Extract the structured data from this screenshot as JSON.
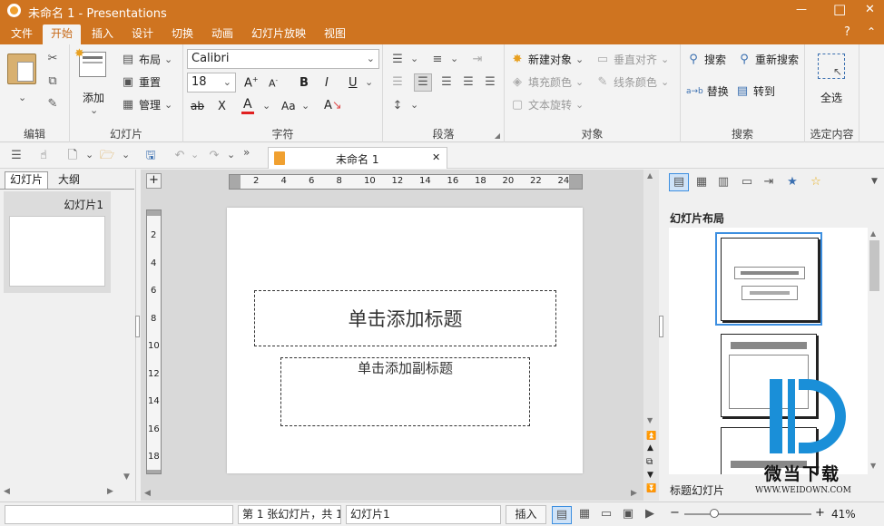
{
  "titlebar": {
    "title": "未命名 1 - Presentations",
    "minimize": "—",
    "maximize": "□",
    "close": "✕"
  },
  "tabs": [
    "文件",
    "开始",
    "插入",
    "设计",
    "切换",
    "动画",
    "幻灯片放映",
    "视图"
  ],
  "help": "?",
  "ribbon": {
    "groups": {
      "edit": "编辑",
      "slides": "幻灯片",
      "font": "字符",
      "para": "段落",
      "object": "对象",
      "search": "搜索",
      "select": "选定内容"
    },
    "add_label": "添加",
    "layout_label": "布局",
    "reset_label": "重置",
    "manage_label": "管理",
    "font_name": "Calibri",
    "font_size": "18",
    "bold": "B",
    "italic": "I",
    "underline": "U",
    "strike": "ab",
    "clear": "X",
    "fontcolor": "A",
    "fontsize_case": "Aa",
    "new_object": "新建对象",
    "fill_color": "填充颜色",
    "text_rotate": "文本旋转",
    "vertical_align": "垂直对齐",
    "line_color": "线条颜色",
    "search": "搜索",
    "research": "重新搜索",
    "replace": "替换",
    "goto": "转到",
    "replace_prefix": "a→b",
    "select_all": "全选"
  },
  "doc_tab": {
    "title": "未命名 1",
    "close": "✕"
  },
  "leftpane": {
    "tab_slides": "幻灯片",
    "tab_outline": "大纲",
    "thumb_label": "幻灯片1"
  },
  "slide": {
    "title_placeholder": "单击添加标题",
    "subtitle_placeholder": "单击添加副标题"
  },
  "ruler": {
    "h": [
      "2",
      "4",
      "6",
      "8",
      "10",
      "12",
      "14",
      "16",
      "18",
      "20",
      "22",
      "24"
    ],
    "v": [
      "2",
      "4",
      "6",
      "8",
      "10",
      "12",
      "14",
      "16",
      "18"
    ]
  },
  "rightpane": {
    "section_title": "幻灯片布局",
    "bottom_label": "标题幻灯片"
  },
  "status": {
    "slide_info": "第 1 张幻灯片，共 1",
    "slide_name": "幻灯片1",
    "insert": "插入",
    "zoom": "41%"
  },
  "watermark": {
    "text": "微当下载",
    "url": "WWW.WEIDOWN.COM"
  },
  "colors": {
    "brand": "#cf7420",
    "accent": "#c86a18",
    "selection": "#3d8fe0",
    "fontcolor_bar": "#e02020"
  }
}
